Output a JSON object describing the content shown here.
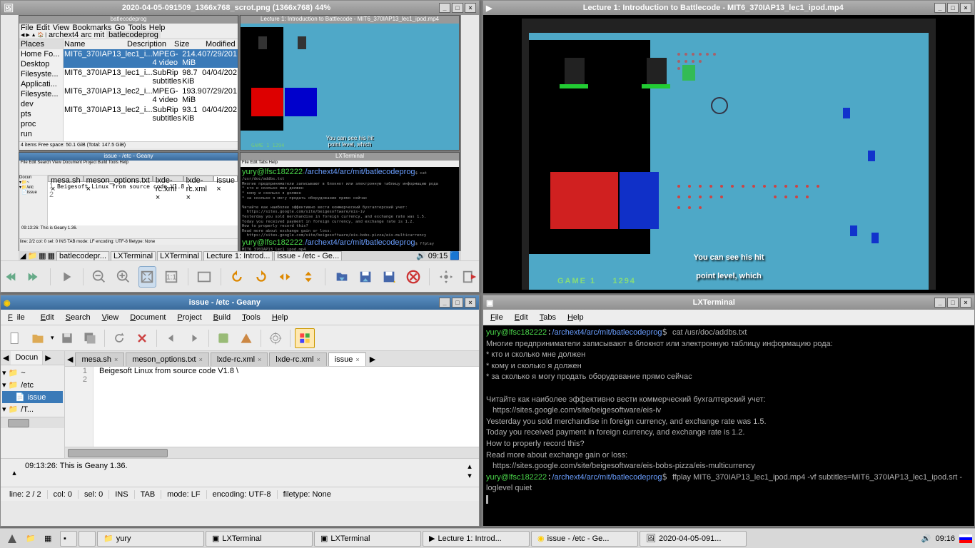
{
  "gpicview": {
    "title": "2020-04-05-091509_1366x768_scrot.png (1366x768) 44%"
  },
  "thumb": {
    "fm_title": "batlecodeprog",
    "menus": [
      "File",
      "Edit",
      "View",
      "Bookmarks",
      "Go",
      "Tools",
      "Help"
    ],
    "path": [
      "archext4",
      "arc",
      "mit",
      "batlecodeprog"
    ],
    "places": [
      "Home Fo...",
      "Desktop",
      "Filesyste...",
      "Applicati...",
      "Filesyste...",
      "dev",
      "pts",
      "proc",
      "run"
    ],
    "cols": [
      "Name",
      "Description",
      "Size",
      "Modified"
    ],
    "files": [
      {
        "n": "MIT6_370IAP13_lec1_i...",
        "d": "MPEG-4 video",
        "s": "214.4 MiB",
        "m": "07/29/201"
      },
      {
        "n": "MIT6_370IAP13_lec1_i...",
        "d": "SubRip subtitles",
        "s": "98.7 KiB",
        "m": "04/04/202"
      },
      {
        "n": "MIT6_370IAP13_lec2_i...",
        "d": "MPEG-4 video",
        "s": "193.9 MiB",
        "m": "07/29/201"
      },
      {
        "n": "MIT6_370IAP13_lec2_i...",
        "d": "SubRip subtitles",
        "s": "93.1 KiB",
        "m": "04/04/202"
      }
    ],
    "status": "4 items                                      Free space: 50.1 GiB (Total: 147.5 GiB)",
    "video_title": "Lecture 1: Introduction to Battlecode - MIT6_370IAP13_lec1_ipod.mp4",
    "geany_title": "issue - /etc - Geany",
    "term_title": "LXTerminal",
    "taskbar_items": [
      "batlecodepr...",
      "LXTerminal",
      "LXTerminal",
      "Lecture 1: Introd...",
      "issue - /etc - Ge..."
    ],
    "time": "09:15"
  },
  "video": {
    "title": "Lecture 1: Introduction to Battlecode - MIT6_370IAP13_lec1_ipod.mp4",
    "subtitle1": "You can see his hit",
    "subtitle2": "point level, which",
    "game_label": "GAME 1",
    "score": "1294"
  },
  "geany": {
    "title": "issue - /etc - Geany",
    "menus": [
      "File",
      "Edit",
      "Search",
      "View",
      "Document",
      "Project",
      "Build",
      "Tools",
      "Help"
    ],
    "sidetab": "Docun",
    "tree": [
      "~",
      "/etc",
      "issue",
      "/T..."
    ],
    "tabs": [
      "mesa.sh",
      "meson_options.txt",
      "lxde-rc.xml",
      "lxde-rc.xml",
      "issue"
    ],
    "active_tab": 4,
    "lines": [
      "1",
      "2"
    ],
    "content": "Beigesoft Linux from source code V1.8 \\\n",
    "msg": "09:13:26: This is Geany 1.36.",
    "status": {
      "line": "line: 2 / 2",
      "col": "col: 0",
      "sel": "sel: 0",
      "ins": "INS",
      "tab": "TAB",
      "mode": "mode: LF",
      "enc": "encoding: UTF-8",
      "filetype": "filetype: None"
    }
  },
  "terminal": {
    "title": "LXTerminal",
    "menus": [
      "File",
      "Edit",
      "Tabs",
      "Help"
    ],
    "prompt1_user": "yury@lfsc182222",
    "prompt1_path": "/archext4/arc/mit/batlecodeprog",
    "cmd1": "cat /usr/doc/addbs.txt",
    "out1": "Многие предприниматели записывают в блокнот или электронную таблицу информацию рода:\n* кто и сколько мне должен\n* кому и сколько я должен\n* за сколько я могу продать оборудование прямо сейчас\n\nЧитайте как наиболее эффективно вести коммерческий бухгалтерский учет:\n   https://sites.google.com/site/beigesoftware/eis-iv\nYesterday you sold merchandise in foreign currency, and exchange rate was 1.5.\nToday you received payment in foreign currency, and exchange rate is 1.2.\nHow to properly record this?\nRead more about exchange gain or loss:\n   https://sites.google.com/site/beigesoftware/eis-bobs-pizza/eis-multicurrency",
    "cmd2": "ffplay MIT6_370IAP13_lec1_ipod.mp4 -vf subtitles=MIT6_370IAP13_lec1_ipod.srt -loglevel quiet"
  },
  "taskbar": {
    "items": [
      "yury",
      "LXTerminal",
      "LXTerminal",
      "Lecture 1: Introd...",
      "issue - /etc - Ge...",
      "2020-04-05-091..."
    ],
    "time": "09:16"
  }
}
